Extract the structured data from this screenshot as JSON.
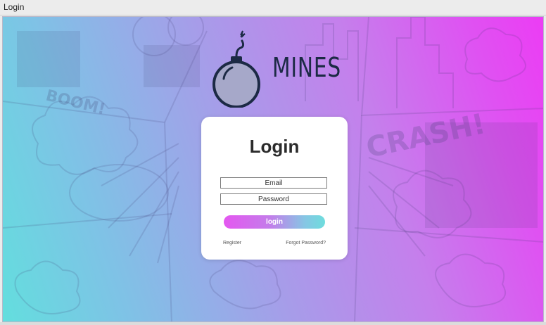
{
  "window": {
    "title": "Login"
  },
  "brand": {
    "name": "MINES",
    "icon": "bomb-icon"
  },
  "login_form": {
    "heading": "Login",
    "email_placeholder": "Email",
    "password_placeholder": "Password",
    "submit_label": "login",
    "register_link": "Register",
    "forgot_link": "Forgot Password?"
  },
  "background": {
    "comic_words": [
      "BOOM!",
      "CRASH!"
    ],
    "gradient_colors": [
      "#63dede",
      "#a69de9",
      "#ec3cf4"
    ]
  },
  "colors": {
    "accent_pink": "#e457f0",
    "accent_teal": "#6edddd",
    "text_dark": "#2b2b2b",
    "logo": "#1c2a45"
  }
}
